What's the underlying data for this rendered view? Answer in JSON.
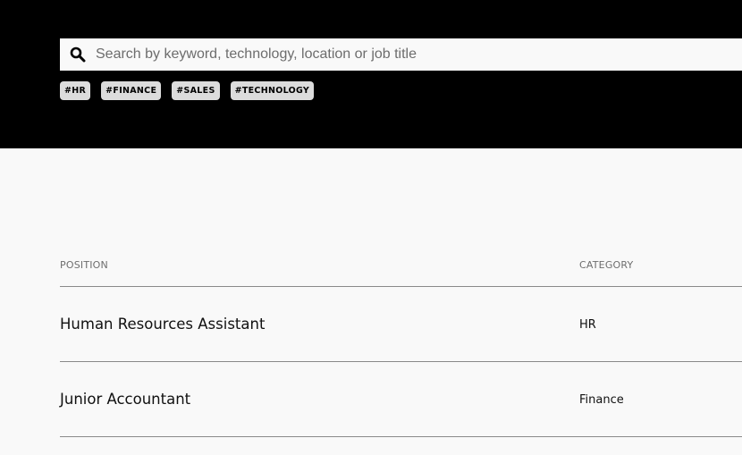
{
  "search": {
    "placeholder": "Search by keyword, technology, location or job title",
    "icon": "search-icon"
  },
  "tags": [
    {
      "label": "#HR"
    },
    {
      "label": "#FINANCE"
    },
    {
      "label": "#SALES"
    },
    {
      "label": "#TECHNOLOGY"
    }
  ],
  "table": {
    "headers": {
      "position": "POSITION",
      "category": "CATEGORY"
    },
    "rows": [
      {
        "title": "Human Resources Assistant",
        "category": "HR"
      },
      {
        "title": "Junior Accountant",
        "category": "Finance"
      }
    ]
  },
  "colors": {
    "hero_bg": "#000000",
    "page_bg": "#f9f9f9",
    "tag_bg": "#dcdcdc"
  }
}
